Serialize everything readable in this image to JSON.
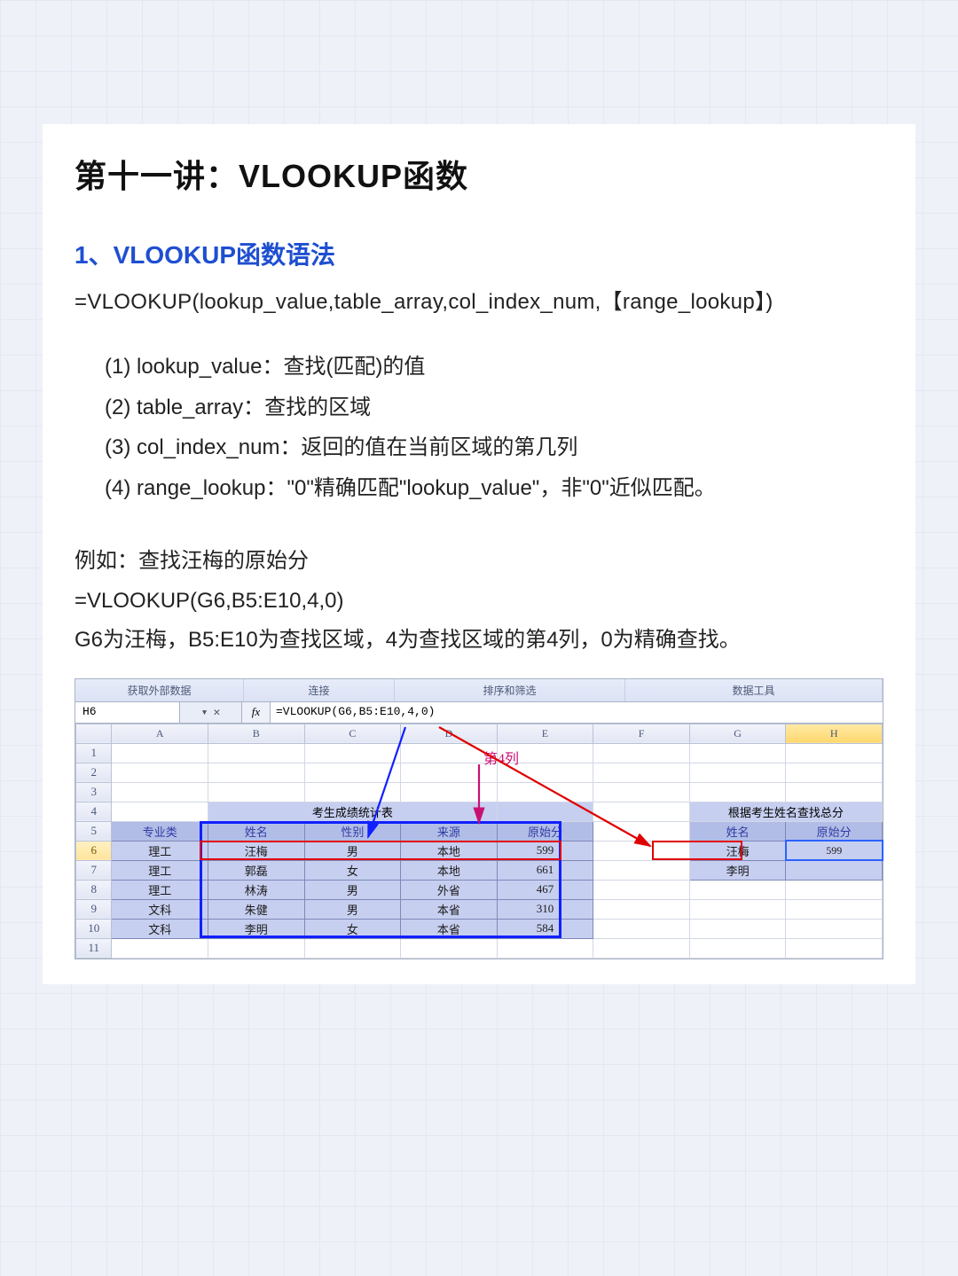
{
  "title": "第十一讲：VLOOKUP函数",
  "section1": {
    "heading": "1、VLOOKUP函数语法",
    "syntax": "=VLOOKUP(lookup_value,table_array,col_index_num,【range_lookup】)",
    "params": [
      "(1)  lookup_value：查找(匹配)的值",
      "(2)  table_array：查找的区域",
      "(3)  col_index_num：返回的值在当前区域的第几列",
      "(4)  range_lookup：\"0\"精确匹配\"lookup_value\"，非\"0\"近似匹配。"
    ]
  },
  "example": {
    "l1": "例如：查找汪梅的原始分",
    "l2": "=VLOOKUP(G6,B5:E10,4,0)",
    "l3": "G6为汪梅，B5:E10为查找区域，4为查找区域的第4列，0为精确查找。"
  },
  "excel": {
    "ribbon": [
      "获取外部数据",
      "连接",
      "排序和筛选",
      "数据工具"
    ],
    "nameBox": "H6",
    "fx": "fx",
    "formula": "=VLOOKUP(G6,B5:E10,4,0)",
    "cols": [
      "A",
      "B",
      "C",
      "D",
      "E",
      "F",
      "G",
      "H"
    ],
    "rows": [
      "1",
      "2",
      "3",
      "4",
      "5",
      "6",
      "7",
      "8",
      "9",
      "10",
      "11"
    ],
    "annotCol4": "第4列",
    "table1": {
      "title": "考生成绩统计表",
      "headers": [
        "专业类",
        "姓名",
        "性别",
        "来源",
        "原始分"
      ],
      "data": [
        {
          "A": "理工",
          "B": "汪梅",
          "C": "男",
          "D": "本地",
          "E": "599"
        },
        {
          "A": "理工",
          "B": "郭磊",
          "C": "女",
          "D": "本地",
          "E": "661"
        },
        {
          "A": "理工",
          "B": "林涛",
          "C": "男",
          "D": "外省",
          "E": "467"
        },
        {
          "A": "文科",
          "B": "朱健",
          "C": "男",
          "D": "本省",
          "E": "310"
        },
        {
          "A": "文科",
          "B": "李明",
          "C": "女",
          "D": "本省",
          "E": "584"
        }
      ]
    },
    "table2": {
      "title": "根据考生姓名查找总分",
      "headers": [
        "姓名",
        "原始分"
      ],
      "data": [
        {
          "G": "汪梅",
          "H": "599"
        },
        {
          "G": "李明",
          "H": ""
        }
      ]
    }
  }
}
